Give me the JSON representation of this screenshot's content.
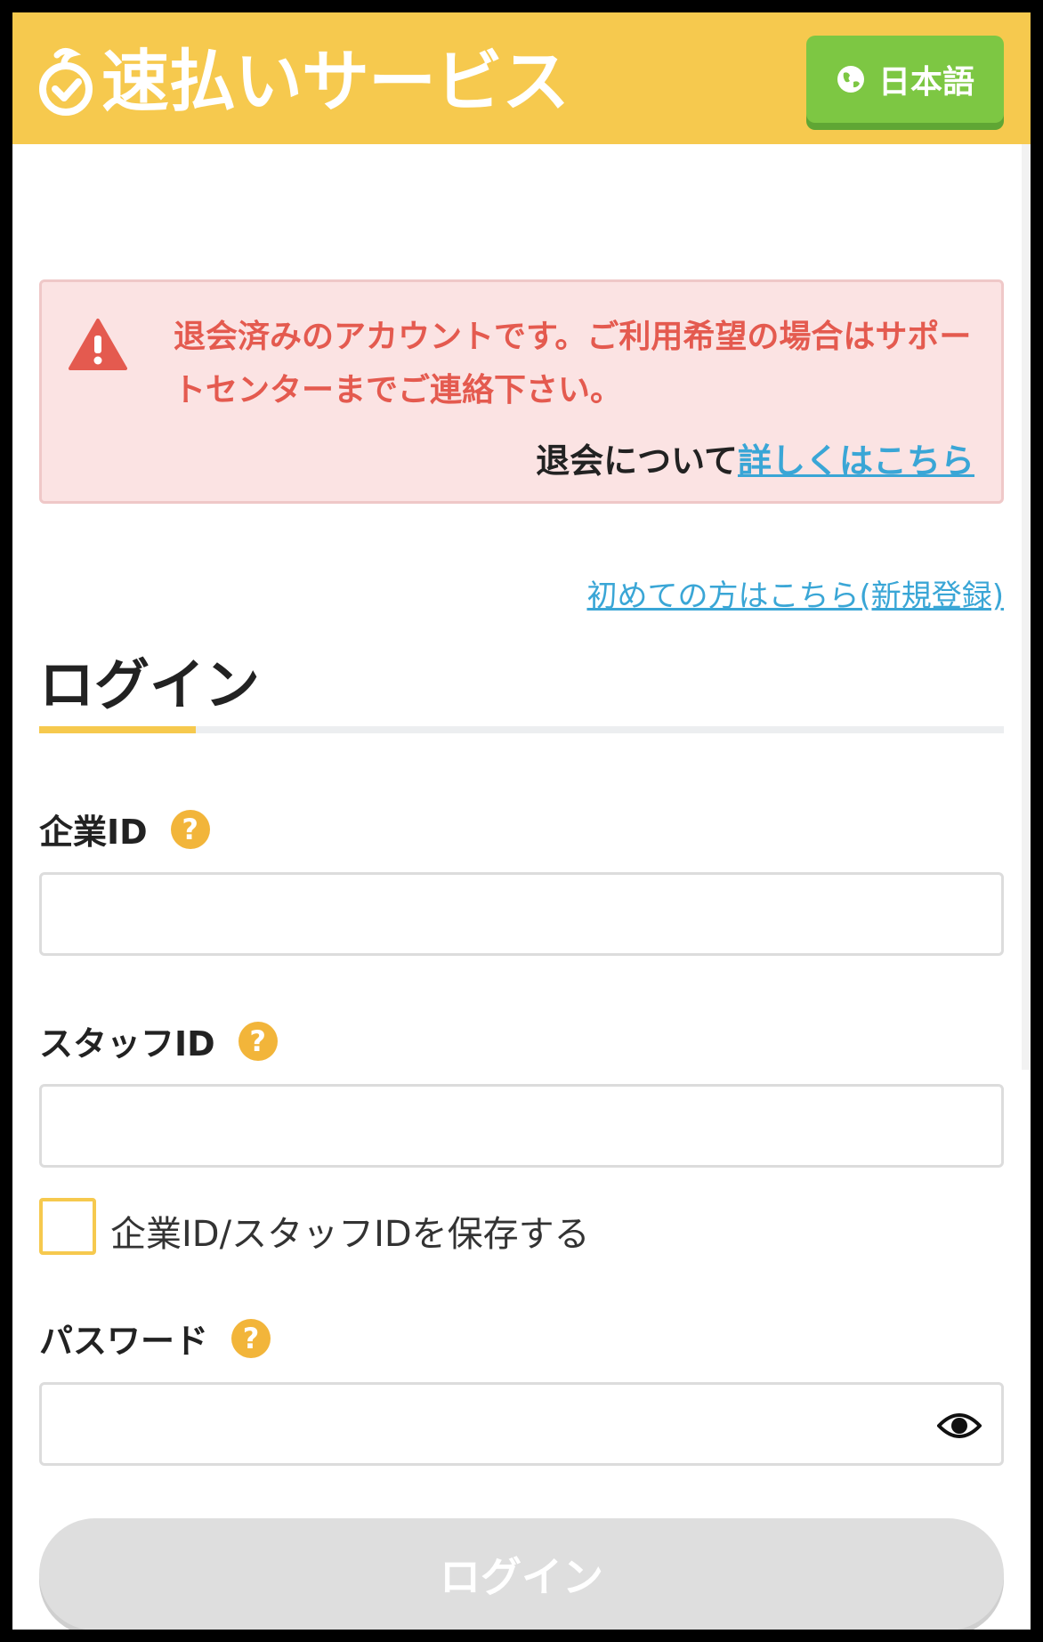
{
  "header": {
    "logo_text": "速払いサービス",
    "language_button": "日本語",
    "bg_color": "#f6c94e",
    "lang_color": "#7dc743"
  },
  "alert": {
    "message": "退会済みのアカウントです。ご利用希望の場合はサポートセンターまでご連絡下さい。",
    "more_prefix": "退会について",
    "more_link": "詳しくはこちら",
    "icon": "warning-icon"
  },
  "signup_link": "初めての方はこちら(新規登録)",
  "login": {
    "title": "ログイン",
    "company_id_label": "企業ID",
    "staff_id_label": "スタッフID",
    "save_ids_label": "企業ID/スタッフIDを保存する",
    "password_label": "パスワード",
    "submit_label": "ログイン",
    "help_icon": "question-circle-icon",
    "password_toggle_icon": "eye-icon"
  }
}
